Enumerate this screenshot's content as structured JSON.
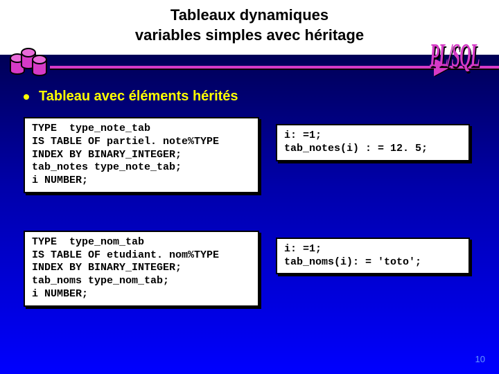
{
  "header": {
    "title_line1": "Tableaux dynamiques",
    "title_line2": "variables simples avec héritage",
    "brand": "PL/SQL"
  },
  "bullet": {
    "text": "Tableau avec éléments hérités"
  },
  "code": {
    "box1": "TYPE  type_note_tab\nIS TABLE OF partiel. note%TYPE\nINDEX BY BINARY_INTEGER;\ntab_notes type_note_tab;\ni NUMBER;",
    "box2": "i: =1;\ntab_notes(i) : = 12. 5;",
    "box3": "TYPE  type_nom_tab\nIS TABLE OF etudiant. nom%TYPE\nINDEX BY BINARY_INTEGER;\ntab_noms type_nom_tab;\ni NUMBER;",
    "box4": "i: =1;\ntab_noms(i): = 'toto';"
  },
  "page": {
    "number": "10"
  }
}
